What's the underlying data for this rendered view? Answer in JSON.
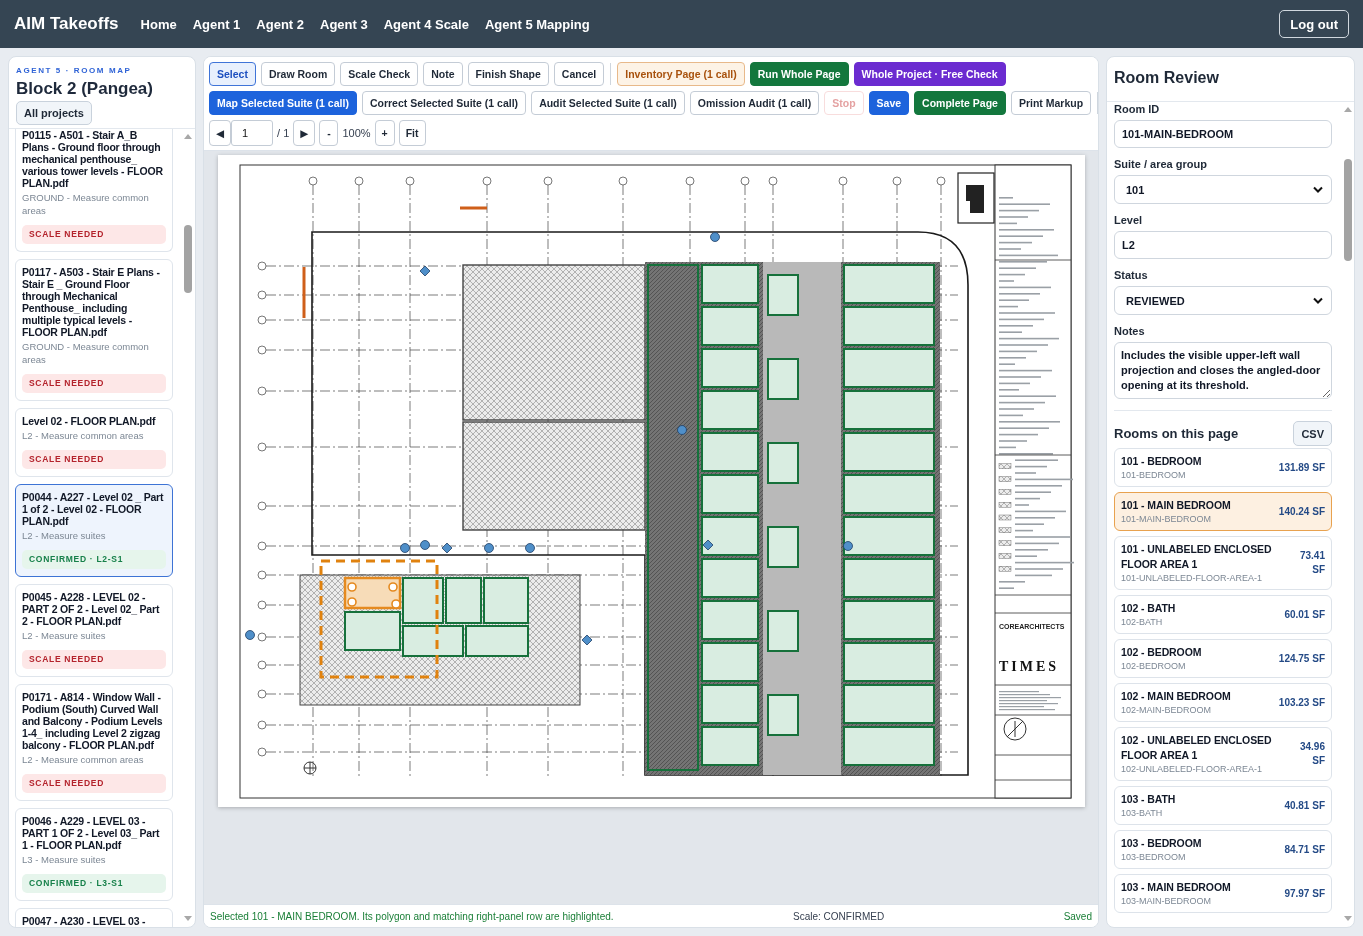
{
  "nav": {
    "brand": "AIM Takeoffs",
    "links": [
      "Home",
      "Agent 1",
      "Agent 2",
      "Agent 3",
      "Agent 4 Scale",
      "Agent 5 Mapping"
    ],
    "logout": "Log out"
  },
  "sidebar": {
    "eyebrow": "AGENT 5 · ROOM MAP",
    "project": "Block 2 (Pangea)",
    "back_button": "All projects",
    "documents": [
      {
        "title": "P0115 - A501 - Stair A_B Plans - Ground floor through mechanical penthouse_ various tower levels - FLOOR PLAN.pdf",
        "subtitle": "GROUND - Measure common areas",
        "badge": {
          "kind": "warning",
          "label": "SCALE NEEDED"
        },
        "selected": false
      },
      {
        "title": "P0117 - A503 - Stair E Plans - Stair E _ Ground Floor through Mechanical Penthouse_ including multiple typical levels - FLOOR PLAN.pdf",
        "subtitle": "GROUND - Measure common areas",
        "badge": {
          "kind": "warning",
          "label": "SCALE NEEDED"
        },
        "selected": false
      },
      {
        "title": "Level 02 - FLOOR PLAN.pdf",
        "subtitle": "L2 - Measure common areas",
        "badge": {
          "kind": "warning",
          "label": "SCALE NEEDED"
        },
        "selected": false
      },
      {
        "title": "P0044 - A227 - Level 02 _ Part 1 of 2 - Level 02 - FLOOR PLAN.pdf",
        "subtitle": "L2 - Measure suites",
        "badge": {
          "kind": "success",
          "label": "CONFIRMED · L2-S1"
        },
        "selected": true
      },
      {
        "title": "P0045 - A228 - LEVEL 02 - PART 2 OF 2 - Level 02_ Part 2 - FLOOR PLAN.pdf",
        "subtitle": "L2 - Measure suites",
        "badge": {
          "kind": "warning",
          "label": "SCALE NEEDED"
        },
        "selected": false
      },
      {
        "title": "P0171 - A814 - Window Wall - Podium (South) Curved Wall and Balcony - Podium Levels 1-4_ including Level 2 zigzag balcony - FLOOR PLAN.pdf",
        "subtitle": "L2 - Measure common areas",
        "badge": {
          "kind": "warning",
          "label": "SCALE NEEDED"
        },
        "selected": false
      },
      {
        "title": "P0046 - A229 - LEVEL 03 - PART 1 OF 2 - Level 03_ Part 1 - FLOOR PLAN.pdf",
        "subtitle": "L3 - Measure suites",
        "badge": {
          "kind": "success",
          "label": "CONFIRMED · L3-S1"
        },
        "selected": false
      },
      {
        "title": "P0047 - A230 - LEVEL 03 -",
        "selected": false
      }
    ]
  },
  "toolbar": {
    "tools": [
      {
        "label": "Select",
        "selected": true
      },
      {
        "label": "Draw Room",
        "selected": false
      },
      {
        "label": "Scale Check",
        "selected": false
      },
      {
        "label": "Note",
        "selected": false
      }
    ],
    "shape_actions": [
      "Finish Shape",
      "Cancel"
    ],
    "run_actions": [
      {
        "label": "Inventory Page (1 call)",
        "kind": "outline-accent"
      },
      {
        "label": "Run Whole Page",
        "kind": "success"
      },
      {
        "label": "Whole Project · Free Check",
        "kind": "purple"
      }
    ],
    "suite_actions": [
      {
        "label": "Map Selected Suite (1 call)",
        "kind": "primary",
        "disabled": false
      },
      {
        "label": "Correct Selected Suite (1 call)",
        "kind": "plain",
        "disabled": false
      },
      {
        "label": "Audit Selected Suite (1 call)",
        "kind": "plain",
        "disabled": false
      },
      {
        "label": "Omission Audit (1 call)",
        "kind": "plain",
        "disabled": false
      },
      {
        "label": "Stop",
        "kind": "danger",
        "disabled": true
      },
      {
        "label": "Save",
        "kind": "primary",
        "disabled": false
      },
      {
        "label": "Complete Page",
        "kind": "success",
        "disabled": false
      },
      {
        "label": "Print Markup",
        "kind": "plain",
        "disabled": false
      }
    ],
    "page_nav": {
      "prev": "◀",
      "page": "1",
      "total": "/ 1",
      "next": "▶",
      "zoom_out": "-",
      "zoom": "100%",
      "zoom_in": "+",
      "fit": "Fit"
    }
  },
  "canvas": {
    "firm_name": "COREARCHITECTS",
    "client_logo": "TIMES"
  },
  "status_bar": {
    "message": "Selected 101 - MAIN BEDROOM. Its polygon and matching right-panel row are highlighted.",
    "scale": "Scale: CONFIRMED",
    "save_state": "Saved"
  },
  "review": {
    "title": "Room Review",
    "fields": [
      {
        "kind": "input",
        "label": "Room ID",
        "value": "101-MAIN-BEDROOM"
      },
      {
        "kind": "select",
        "label": "Suite / area group",
        "value": "101"
      },
      {
        "kind": "input",
        "label": "Level",
        "value": "L2"
      },
      {
        "kind": "select",
        "label": "Status",
        "value": "REVIEWED"
      },
      {
        "kind": "textarea",
        "label": "Notes",
        "value": "Includes the visible upper-left wall projection and closes the angled-door opening at its threshold."
      }
    ],
    "rooms_heading": "Rooms on this page",
    "export_button": "CSV",
    "rooms": [
      {
        "name": "101 - BEDROOM",
        "id": "101-BEDROOM",
        "area": "131.89 SF",
        "selected": false
      },
      {
        "name": "101 - MAIN BEDROOM",
        "id": "101-MAIN-BEDROOM",
        "area": "140.24 SF",
        "selected": true
      },
      {
        "name": "101 - UNLABELED ENCLOSED FLOOR AREA 1",
        "id": "101-UNLABELED-FLOOR-AREA-1",
        "area": "73.41 SF",
        "selected": false
      },
      {
        "name": "102 - BATH",
        "id": "102-BATH",
        "area": "60.01 SF",
        "selected": false
      },
      {
        "name": "102 - BEDROOM",
        "id": "102-BEDROOM",
        "area": "124.75 SF",
        "selected": false
      },
      {
        "name": "102 - MAIN BEDROOM",
        "id": "102-MAIN-BEDROOM",
        "area": "103.23 SF",
        "selected": false
      },
      {
        "name": "102 - UNLABELED ENCLOSED FLOOR AREA 1",
        "id": "102-UNLABELED-FLOOR-AREA-1",
        "area": "34.96 SF",
        "selected": false
      },
      {
        "name": "103 - BATH",
        "id": "103-BATH",
        "area": "40.81 SF",
        "selected": false
      },
      {
        "name": "103 - BEDROOM",
        "id": "103-BEDROOM",
        "area": "84.71 SF",
        "selected": false
      },
      {
        "name": "103 - MAIN BEDROOM",
        "id": "103-MAIN-BEDROOM",
        "area": "97.97 SF",
        "selected": false
      }
    ]
  }
}
